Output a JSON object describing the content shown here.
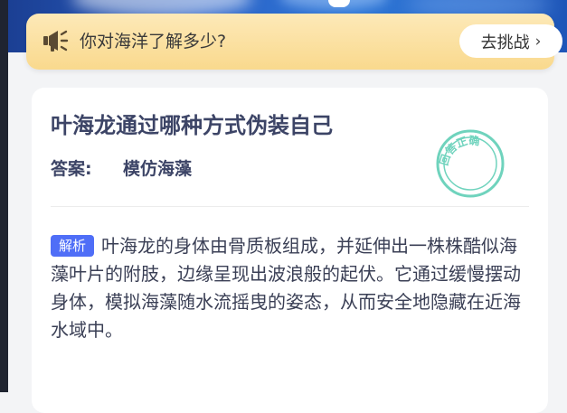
{
  "banner": {
    "icon": "megaphone-icon",
    "text": "你对海洋了解多少?",
    "button_label": "去挑战",
    "button_chevron": "›"
  },
  "card": {
    "title": "叶海龙通过哪种方式伪装自己",
    "answer_label": "答案:",
    "answer_value": "模仿海藻",
    "stamp_text": "回答正确",
    "analysis_badge": "解析",
    "analysis_text": "叶海龙的身体由骨质板组成，并延伸出一株株酷似海藻叶片的附肢，边缘呈现出波浪般的起伏。它通过缓慢摆动身体，模拟海藻随水流摇曳的姿态，从而安全地隐藏在近海水域中。"
  },
  "colors": {
    "accent": "#4f6ef7",
    "title": "#3c4466",
    "stamp": "#6fd3bd",
    "banner": "#fbe2a4"
  }
}
